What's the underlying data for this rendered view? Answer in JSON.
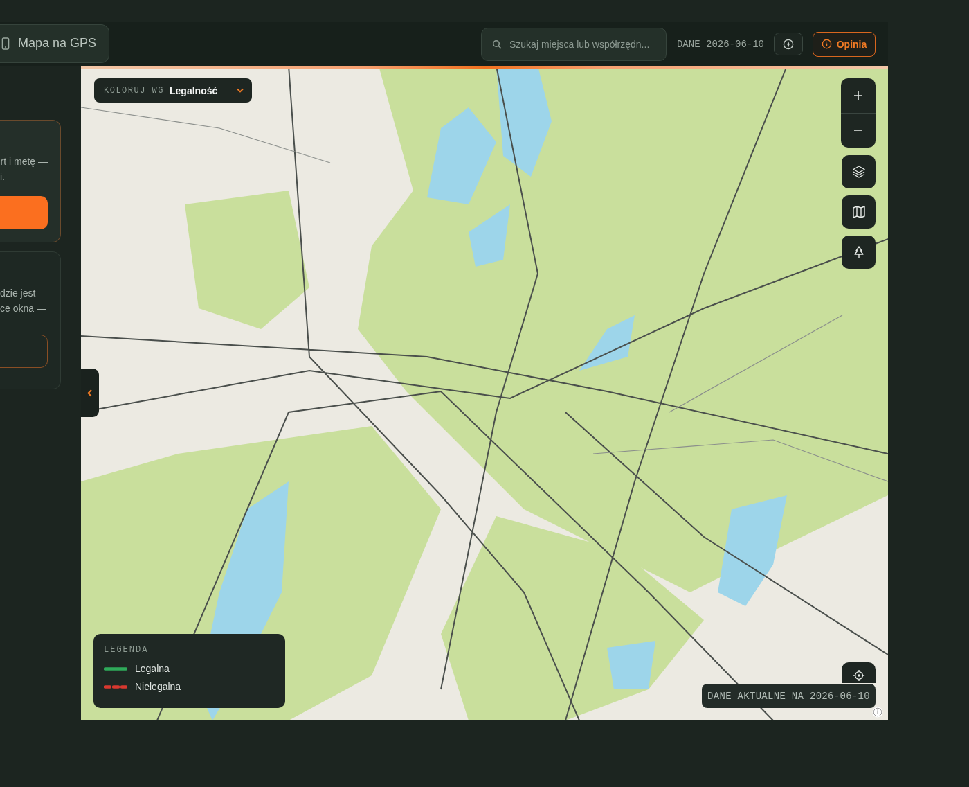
{
  "sidebar": {
    "gps_button": "Mapa na GPS",
    "cards": [
      {
        "kind": "primary",
        "lines": [
          "rt i metę —",
          "i."
        ]
      },
      {
        "kind": "secondary",
        "lines": [
          "dzie jest",
          "ce okna —"
        ]
      }
    ]
  },
  "header": {
    "search": {
      "placeholder": "Szukaj miejsca lub współrzędn..."
    },
    "data_date": "DANE 2026-06-10",
    "feedback_button": "Opinia"
  },
  "map": {
    "color_by": {
      "label": "KOLORUJ WG",
      "value": "Legalność"
    },
    "legend": {
      "title": "LEGENDA",
      "items": [
        {
          "label": "Legalna",
          "color": "#2faa5a",
          "kind": "solid"
        },
        {
          "label": "Nielegalna",
          "color": "#d8382f",
          "kind": "dashed"
        }
      ]
    },
    "data_note": "DANE AKTUALNE NA 2026-06-10"
  }
}
